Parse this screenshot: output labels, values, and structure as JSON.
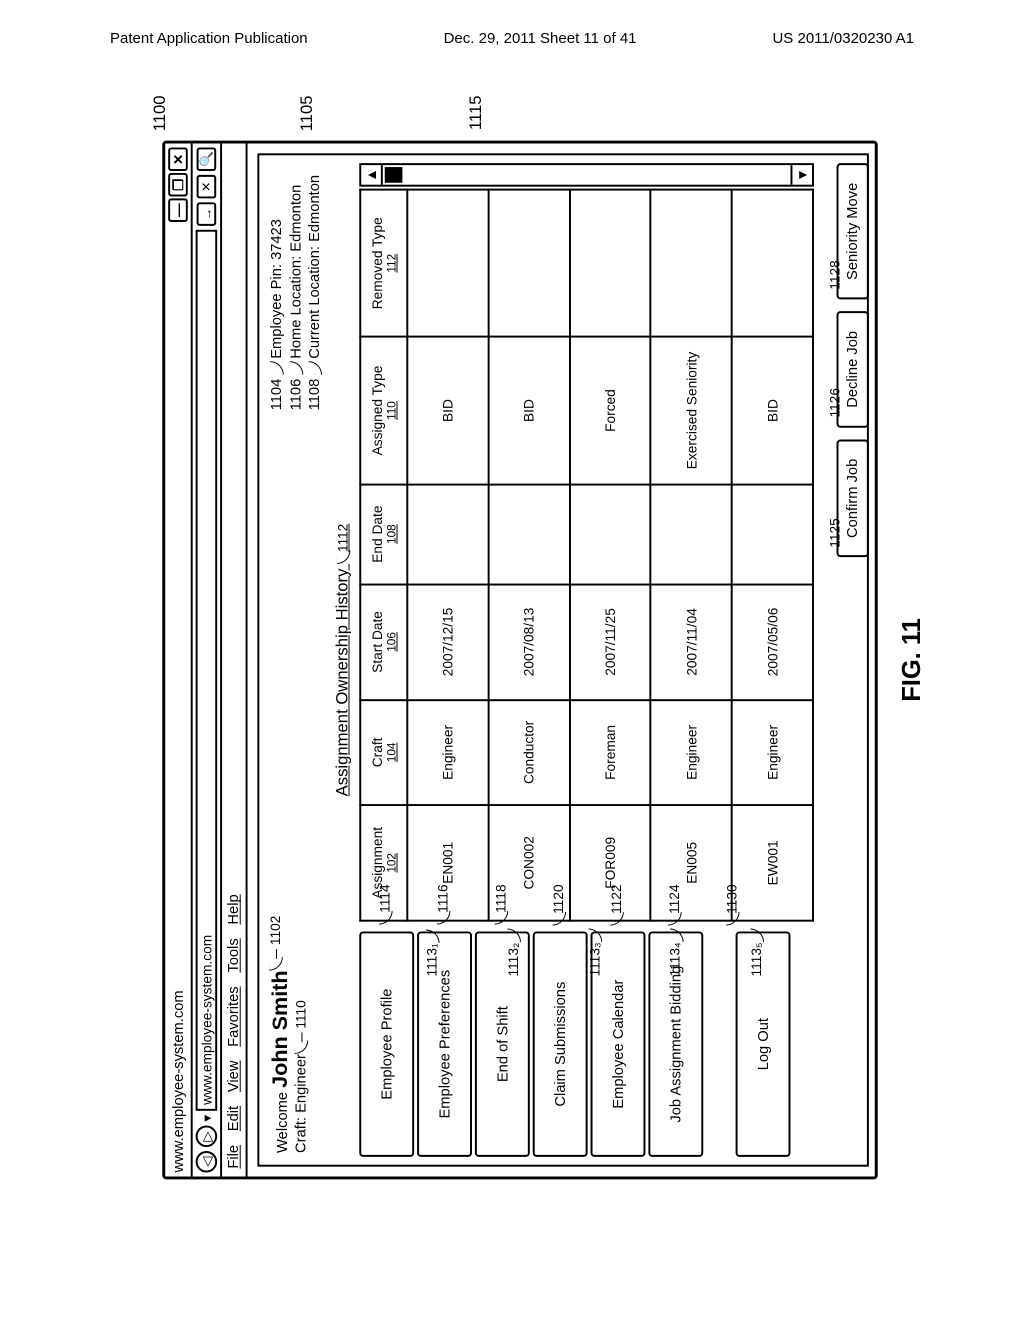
{
  "page_header": {
    "left": "Patent Application Publication",
    "center": "Dec. 29, 2011  Sheet 11 of 41",
    "right": "US 2011/0320230 A1"
  },
  "figure_label": "FIG. 11",
  "outer_refs": {
    "window_ref": "1100",
    "inner_ref": "1105",
    "table_ref": "1115"
  },
  "browser": {
    "title": "www.employee-system.com",
    "url": "www.employee-system.com",
    "window_buttons": {
      "min": "—",
      "max": "❐",
      "close": "✕"
    },
    "go_label": "→",
    "dropdown": "▾",
    "back": "◁",
    "fwd": "▷",
    "search": "🔍",
    "addr_close": "✕",
    "menu": [
      "File",
      "Edit",
      "View",
      "Favorites",
      "Tools",
      "Help"
    ]
  },
  "welcome": {
    "prefix": "Welcome",
    "name": "John Smith",
    "name_ref": "1102",
    "craft_label": "Craft:",
    "craft_value": "Engineer",
    "craft_ref": "1110"
  },
  "emp_info": {
    "pin_label": "Employee Pin:",
    "pin_value": "37423",
    "pin_ref": "1104",
    "home_label": "Home Location:",
    "home_value": "Edmonton",
    "home_ref": "1106",
    "curr_label": "Current Location:",
    "curr_value": "Edmonton",
    "curr_ref": "1108"
  },
  "section_title": "Assignment Ownership History",
  "section_title_ref": "1112",
  "sidebar": [
    {
      "label": "Employee Profile",
      "ref": "1114"
    },
    {
      "label": "Employee Preferences",
      "ref": "1116"
    },
    {
      "label": "End of Shift",
      "ref": "1118"
    },
    {
      "label": "Claim Submissions",
      "ref": "1120"
    },
    {
      "label": "Employee Calendar",
      "ref": "1122"
    },
    {
      "label": "Job Assignment Bidding",
      "ref": "1124"
    },
    {
      "label": "Log Out",
      "ref": "1130"
    }
  ],
  "columns": [
    {
      "label": "Assignment",
      "num": "102"
    },
    {
      "label": "Craft",
      "num": "104"
    },
    {
      "label": "Start Date",
      "num": "106"
    },
    {
      "label": "End Date",
      "num": "108"
    },
    {
      "label": "Assigned Type",
      "num": "110"
    },
    {
      "label": "Removed Type",
      "num": "112"
    }
  ],
  "rows": [
    {
      "ref": "1113₁",
      "assignment": "EN001",
      "craft": "Engineer",
      "start": "2007/12/15",
      "end": "",
      "assigned": "BID",
      "removed": ""
    },
    {
      "ref": "1113₂",
      "assignment": "CON002",
      "craft": "Conductor",
      "start": "2007/08/13",
      "end": "",
      "assigned": "BID",
      "removed": ""
    },
    {
      "ref": "1113₃",
      "assignment": "FOR009",
      "craft": "Foreman",
      "start": "2007/11/25",
      "end": "",
      "assigned": "Forced",
      "removed": ""
    },
    {
      "ref": "1113₄",
      "assignment": "EN005",
      "craft": "Engineer",
      "start": "2007/11/04",
      "end": "",
      "assigned": "Exercised Seniority",
      "removed": ""
    },
    {
      "ref": "1113₅",
      "assignment": "EW001",
      "craft": "Engineer",
      "start": "2007/05/06",
      "end": "",
      "assigned": "BID",
      "removed": ""
    }
  ],
  "buttons": {
    "confirm": {
      "label": "Confirm Job",
      "ref": "1125"
    },
    "decline": {
      "label": "Decline Job",
      "ref": "1126"
    },
    "move": {
      "label": "Seniority Move",
      "ref": "1128"
    }
  },
  "scroll": {
    "up": "▲",
    "down": "▼"
  }
}
